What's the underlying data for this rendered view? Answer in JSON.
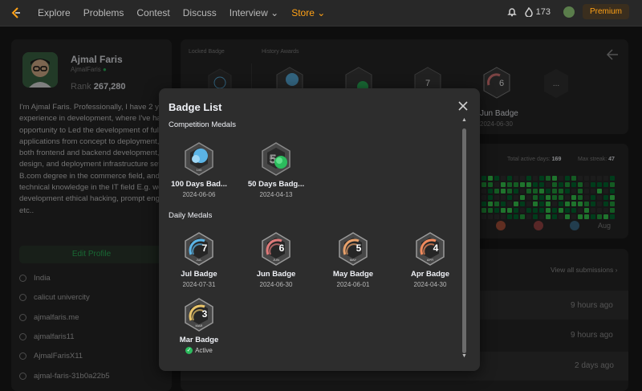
{
  "nav": {
    "items": [
      "Explore",
      "Problems",
      "Contest",
      "Discuss",
      "Interview",
      "Store"
    ],
    "coins": "173",
    "premium": "Premium"
  },
  "profile": {
    "name": "Ajmal Faris",
    "handle": "AjmalFaris",
    "rank_label": "Rank",
    "rank_value": "267,280",
    "bio": "I'm Ajmal Faris. Professionally, I have 2 years of experience in development, where I've had the opportunity to Led the development of full-stack web applications from concept to deployment, involving both frontend and backend development, database design, and deployment infrastructure setup. I hold a B.com degree in the commerce field, and I have good technical knowledge in the IT field E.g. web development ethical hacking, prompt engineering, etc..",
    "edit_button": "Edit Profile",
    "location": "India",
    "school": "calicut univercity",
    "website": "ajmalfaris.me",
    "github": "ajmalfaris11",
    "twitter": "AjmalFarisX11",
    "linkedin": "ajmal-faris-31b0a22b5"
  },
  "badges_panel": {
    "locked_label": "Locked Badge",
    "history_label": "History Awards",
    "jun_badge_name": "Jun Badge",
    "jun_badge_date": "2024-06-30",
    "more": "..."
  },
  "calendar": {
    "active_days_label": "Total active days:",
    "active_days_value": "169",
    "max_streak_label": "Max streak:",
    "max_streak_value": "47",
    "month": "Aug"
  },
  "submissions": {
    "view_all": "View all submissions",
    "times": [
      "9 hours ago",
      "9 hours ago",
      "2 days ago"
    ]
  },
  "modal": {
    "title": "Badge List",
    "competition_title": "Competition Medals",
    "daily_title": "Daily Medals",
    "competition": [
      {
        "name": "100 Days Bad...",
        "date": "2024-06-06",
        "icon": "100-days-badge-icon"
      },
      {
        "name": "50 Days Badg...",
        "date": "2024-04-13",
        "icon": "50-days-badge-icon"
      }
    ],
    "daily": [
      {
        "name": "Jul Badge",
        "date": "2024-07-31",
        "num": "7",
        "mon": "JUL",
        "color": "#5bb4e6"
      },
      {
        "name": "Jun Badge",
        "date": "2024-06-30",
        "num": "6",
        "mon": "JUN",
        "color": "#e07a7a"
      },
      {
        "name": "May Badge",
        "date": "2024-06-01",
        "num": "5",
        "mon": "MAY",
        "color": "#e8a16b"
      },
      {
        "name": "Apr Badge",
        "date": "2024-04-30",
        "num": "4",
        "mon": "APR",
        "color": "#f08a5d"
      },
      {
        "name": "Mar Badge",
        "active": "Active",
        "num": "3",
        "mon": "MAR",
        "color": "#e9c46a"
      }
    ]
  }
}
